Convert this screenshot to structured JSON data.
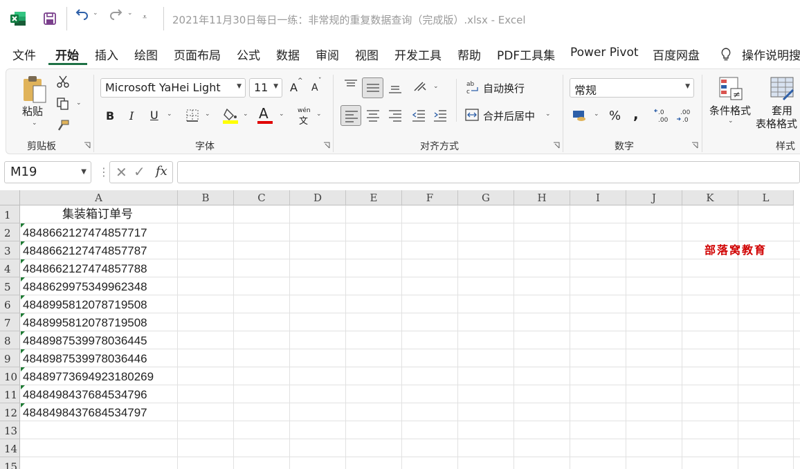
{
  "titlebar": {
    "title": "2021年11月30日每日一练：非常规的重复数据查询（完成版）.xlsx  -  Excel"
  },
  "menu": {
    "tabs": [
      "文件",
      "开始",
      "插入",
      "绘图",
      "页面布局",
      "公式",
      "数据",
      "审阅",
      "视图",
      "开发工具",
      "帮助",
      "PDF工具集",
      "Power Pivot",
      "百度网盘",
      "操作说明搜"
    ],
    "active": "开始"
  },
  "ribbon": {
    "clipboard": {
      "paste_label": "粘贴",
      "group_label": "剪贴板"
    },
    "font": {
      "font_name": "Microsoft YaHei Light",
      "font_size": "11",
      "group_label": "字体",
      "bold": "B",
      "italic": "I",
      "underline": "U",
      "wen_label": "wén",
      "wen_char": "文",
      "grow": "A",
      "shrink": "A",
      "font_color_letter": "A"
    },
    "alignment": {
      "wrap_label": "自动换行",
      "merge_label": "合并后居中",
      "group_label": "对齐方式"
    },
    "number": {
      "format": "常规",
      "percent": "%",
      "comma": ",",
      "group_label": "数字"
    },
    "styles": {
      "conditional_label": "条件格式",
      "table_label_1": "套用",
      "table_label_2": "表格格式",
      "group_label": "样式"
    }
  },
  "formula_bar": {
    "name_box": "M19",
    "fx": "fx",
    "value": ""
  },
  "sheet": {
    "columns": [
      "A",
      "B",
      "C",
      "D",
      "E",
      "F",
      "G",
      "H",
      "I",
      "J",
      "K",
      "L"
    ],
    "rows": [
      "1",
      "2",
      "3",
      "4",
      "5",
      "6",
      "7",
      "8",
      "9",
      "10",
      "11",
      "12",
      "13",
      "14",
      "15"
    ],
    "header_cell": "集装箱订单号",
    "values": [
      "4848662127474857717",
      "4848662127474857787",
      "4848662127474857788",
      "4848629975349962348",
      "4848995812078719508",
      "4848995812078719508",
      "4848987539978036445",
      "4848987539978036446",
      "4848977369492318026​9",
      "4848498437684534796",
      "4848498437684534797"
    ],
    "watermark": "部落窝教育"
  },
  "colors": {
    "accent": "#1e7145",
    "error_triangle": "#1e7b34",
    "watermark": "#d00000"
  }
}
